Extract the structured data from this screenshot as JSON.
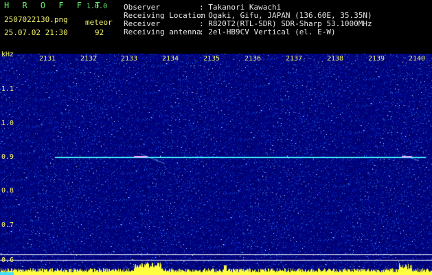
{
  "header": {
    "app_title": "H R O F F T",
    "app_version": "1.0.0",
    "filename": "2507022130.png",
    "datetime": "25.07.02 21:30",
    "mode_label": "meteor",
    "mode_value": "92",
    "info": [
      {
        "label": "Observer",
        "value": ": Takanori Kawachi"
      },
      {
        "label": "Receiving Location",
        "value": ": Ogaki, Gifu, JAPAN (136.60E, 35.35N)"
      },
      {
        "label": "Receiver",
        "value": ": R820T2(RTL-SDR) SDR-Sharp 53.1000MHz"
      },
      {
        "label": "Receiving antenna",
        "value": ": 2el-HB9CV Vertical (el. E-W)"
      }
    ]
  },
  "axes": {
    "y_unit": "kHz",
    "y_ticks": [
      "1.1",
      "1.0",
      "0.9",
      "0.8",
      "0.7",
      "0.6"
    ],
    "x_ticks": [
      "2131",
      "2132",
      "2133",
      "2134",
      "2135",
      "2136",
      "2137",
      "2138",
      "2139",
      "2140"
    ]
  },
  "colors": {
    "background": "#00007a",
    "carrier": "#3ff0ff",
    "level_bars": "#ffff40",
    "level_base": "#40e0ff",
    "grid": "#ffffff"
  }
}
